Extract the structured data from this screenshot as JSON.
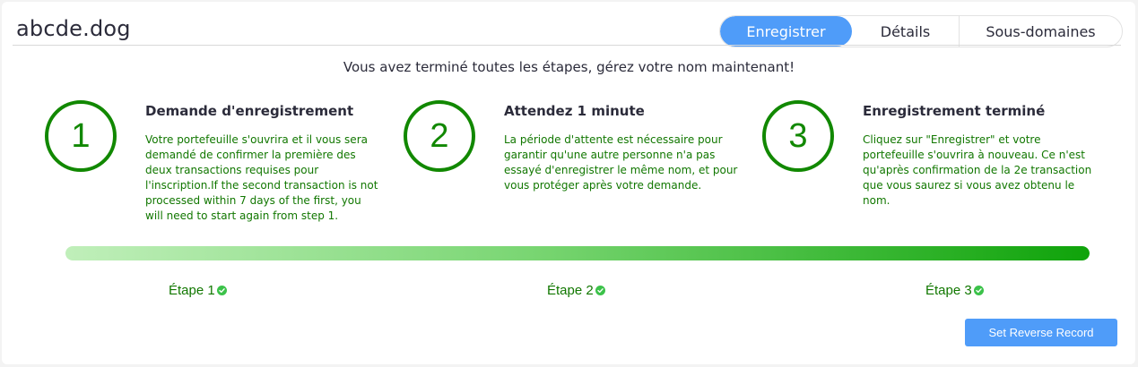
{
  "header": {
    "domain": "abcde.dog",
    "tabs": [
      {
        "label": "Enregistrer",
        "active": true
      },
      {
        "label": "Détails",
        "active": false
      },
      {
        "label": "Sous-domaines",
        "active": false
      }
    ]
  },
  "intro": "Vous avez terminé toutes les étapes, gérez votre nom maintenant!",
  "steps": [
    {
      "number": "1",
      "title": "Demande d'enregistrement",
      "description": "Votre portefeuille s'ouvrira et il vous sera demandé de confirmer la première des deux transactions requises pour l'inscription.If the second transaction is not processed within 7 days of the first, you will need to start again from step 1."
    },
    {
      "number": "2",
      "title": "Attendez 1 minute",
      "description": "La période d'attente est nécessaire pour garantir qu'une autre personne n'a pas essayé d'enregistrer le même nom, et pour vous protéger après votre demande."
    },
    {
      "number": "3",
      "title": "Enregistrement terminé",
      "description": "Cliquez sur \"Enregistrer\" et votre portefeuille s'ouvrira à nouveau. Ce n'est qu'après confirmation de la 2e transaction que vous saurez si vous avez obtenu le nom."
    }
  ],
  "progress": {
    "percent": 100
  },
  "step_labels": [
    "Étape 1",
    "Étape 2",
    "Étape 3"
  ],
  "actions": {
    "reverse_record": "Set Reverse Record"
  },
  "colors": {
    "accent": "#4f9cf9",
    "step_green": "#118800",
    "check_green": "#3cc24a"
  },
  "icons": {
    "step_complete": "check-circle-icon"
  }
}
